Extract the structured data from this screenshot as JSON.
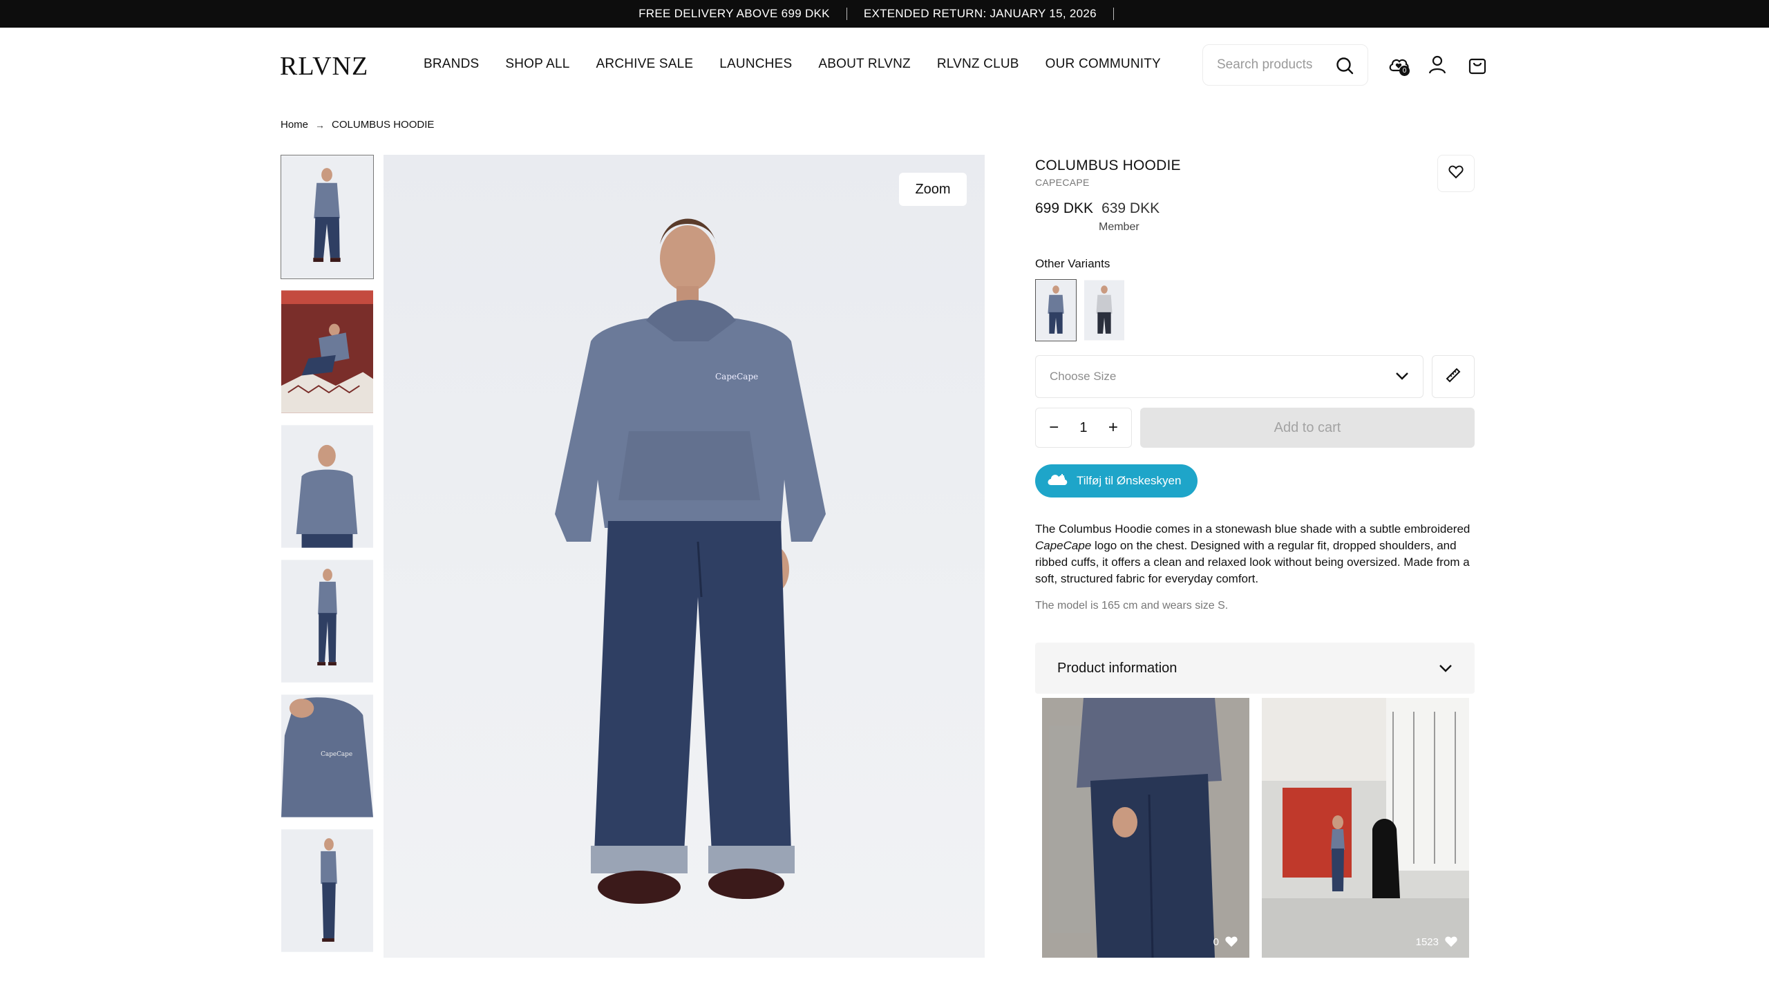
{
  "announcement": {
    "delivery": "FREE DELIVERY ABOVE 699 DKK",
    "returns": "EXTENDED RETURN: JANUARY 15, 2026"
  },
  "header": {
    "logo": "RLVNZ",
    "nav": [
      "BRANDS",
      "SHOP ALL",
      "ARCHIVE SALE",
      "LAUNCHES",
      "ABOUT RLVNZ",
      "RLVNZ CLUB",
      "OUR COMMUNITY"
    ],
    "search_placeholder": "Search products",
    "wishlist_count": "0"
  },
  "breadcrumb": {
    "home": "Home",
    "current": "COLUMBUS HOODIE"
  },
  "gallery": {
    "zoom_label": "Zoom",
    "thumbnail_count": 6
  },
  "product": {
    "title": "COLUMBUS HOODIE",
    "brand": "CAPECAPE",
    "price": "699 DKK",
    "member_price": "639 DKK",
    "member_label": "Member",
    "variants_label": "Other Variants",
    "size_placeholder": "Choose Size",
    "quantity": "1",
    "add_to_cart": "Add to cart",
    "wishcloud_label": "Tilføj til Ønskeskyen",
    "description_part1": "The Columbus Hoodie comes in a stonewash blue shade with a subtle embroidered ",
    "description_brand": "CapeCape",
    "description_part2": " logo on the chest. Designed with a regular fit, dropped shoulders, and ribbed cuffs, it offers a clean and relaxed look without being oversized. Made from a soft, structured fabric for everyday comfort.",
    "model_info": "The model is 165 cm and wears size S.",
    "accordion_label": "Product information"
  },
  "ugc": [
    {
      "likes": "0"
    },
    {
      "likes": "1523"
    }
  ],
  "colors": {
    "accent_wishcloud": "#1ea5c9",
    "announce_bg": "#0d0d0d",
    "hoodie": "#6b7a99",
    "denim": "#2f3f63"
  }
}
